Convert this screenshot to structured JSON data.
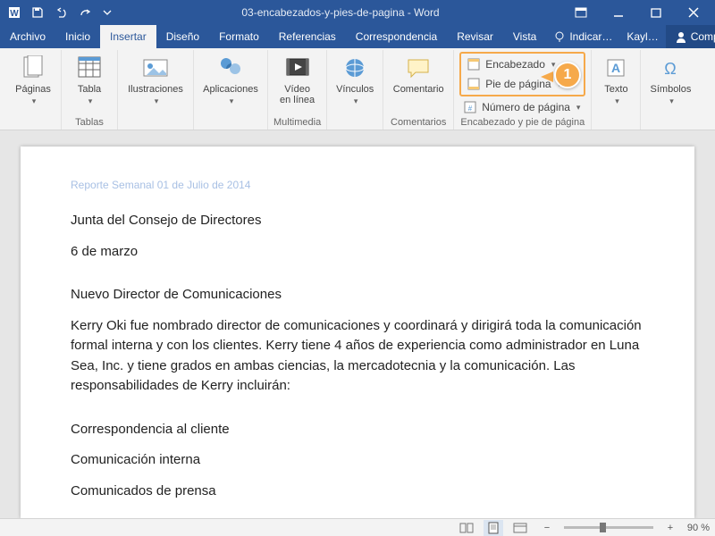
{
  "title": "03-encabezados-y-pies-de-pagina  -  Word",
  "tabs": [
    "Archivo",
    "Inicio",
    "Insertar",
    "Diseño",
    "Formato",
    "Referencias",
    "Correspondencia",
    "Revisar",
    "Vista"
  ],
  "active_tab_index": 2,
  "tellme_placeholder": "Indicar…",
  "user": "Kayl…",
  "share": "Compartir",
  "ribbon": {
    "paginas": {
      "label": "Páginas",
      "group": ""
    },
    "tablas": {
      "label": "Tabla",
      "group": "Tablas"
    },
    "ilustraciones": {
      "label": "Ilustraciones",
      "group": ""
    },
    "aplicaciones": {
      "label": "Aplicaciones",
      "group": ""
    },
    "video": {
      "label": "Vídeo\nen línea",
      "group": "Multimedia"
    },
    "vinculos": {
      "label": "Vínculos",
      "group": ""
    },
    "comentario": {
      "label": "Comentario",
      "group": "Comentarios"
    },
    "header_footer": {
      "encabezado": "Encabezado",
      "pie": "Pie de página",
      "numero": "Número de página",
      "group": "Encabezado y pie de página"
    },
    "texto": {
      "label": "Texto",
      "group": ""
    },
    "simbolos": {
      "label": "Símbolos",
      "group": ""
    }
  },
  "callout": "1",
  "document": {
    "header": "Reporte Semanal 01 de Julio de 2014",
    "p1": "Junta del Consejo de Directores",
    "p2": "6 de marzo",
    "p3": "Nuevo Director de Comunicaciones",
    "p4": "Kerry Oki fue nombrado director de comunicaciones y coordinará y dirigirá toda la comunicación formal interna y con los clientes. Kerry tiene 4 años de experiencia como administrador en Luna Sea, Inc. y tiene grados en ambas ciencias, la mercadotecnia y la comunicación. Las responsabilidades de Kerry incluirán:",
    "p5": "Correspondencia al cliente",
    "p6": "Comunicación interna",
    "p7": "Comunicados de prensa"
  },
  "statusbar": {
    "zoom": "90 %"
  }
}
